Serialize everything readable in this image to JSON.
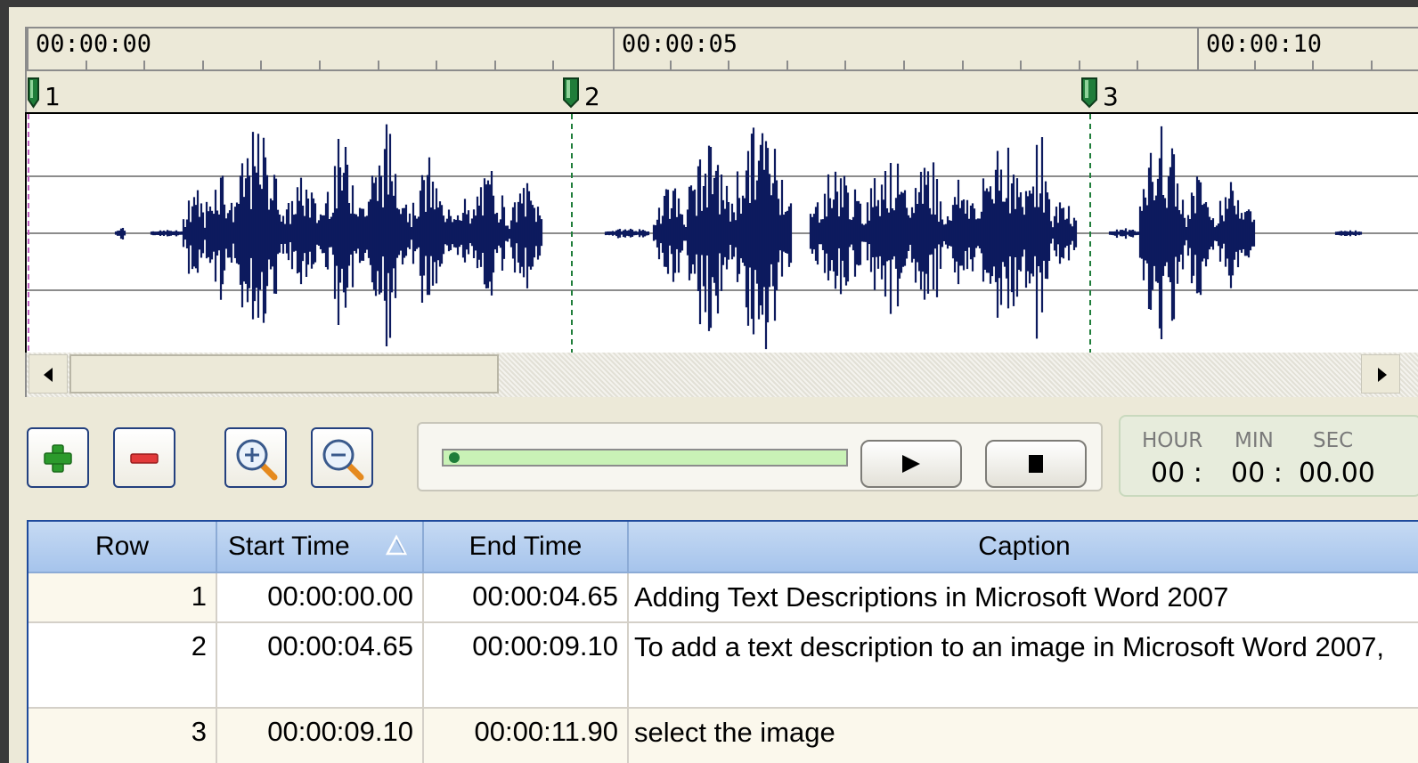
{
  "timeline": {
    "ruler_labels": [
      "00:00:00",
      "00:00:05",
      "00:00:10"
    ],
    "markers": [
      "1",
      "2",
      "3"
    ],
    "marker_color": "#1f7d3a",
    "waveform_color": "#0d1a5e"
  },
  "transport": {
    "progress_fraction": 0.0,
    "time_display": {
      "hour_label": "HOUR",
      "min_label": "MIN",
      "sec_label": "SEC",
      "hour_value": "00 :",
      "min_value": "00 :",
      "sec_value": "00.00"
    }
  },
  "table": {
    "columns": [
      "Row",
      "Start Time",
      "End Time",
      "Caption"
    ],
    "rows": [
      {
        "row": "1",
        "start": "00:00:00.00",
        "end": "00:00:04.65",
        "caption": "Adding Text Descriptions in Microsoft Word 2007"
      },
      {
        "row": "2",
        "start": "00:00:04.65",
        "end": "00:00:09.10",
        "caption": "To add a text description to an image in Microsoft Word 2007,"
      },
      {
        "row": "3",
        "start": "00:00:09.10",
        "end": "00:00:11.90",
        "caption": "select the image"
      }
    ],
    "header_color": "#a6c4ec",
    "alt_row_color": "#fbf8ec"
  }
}
